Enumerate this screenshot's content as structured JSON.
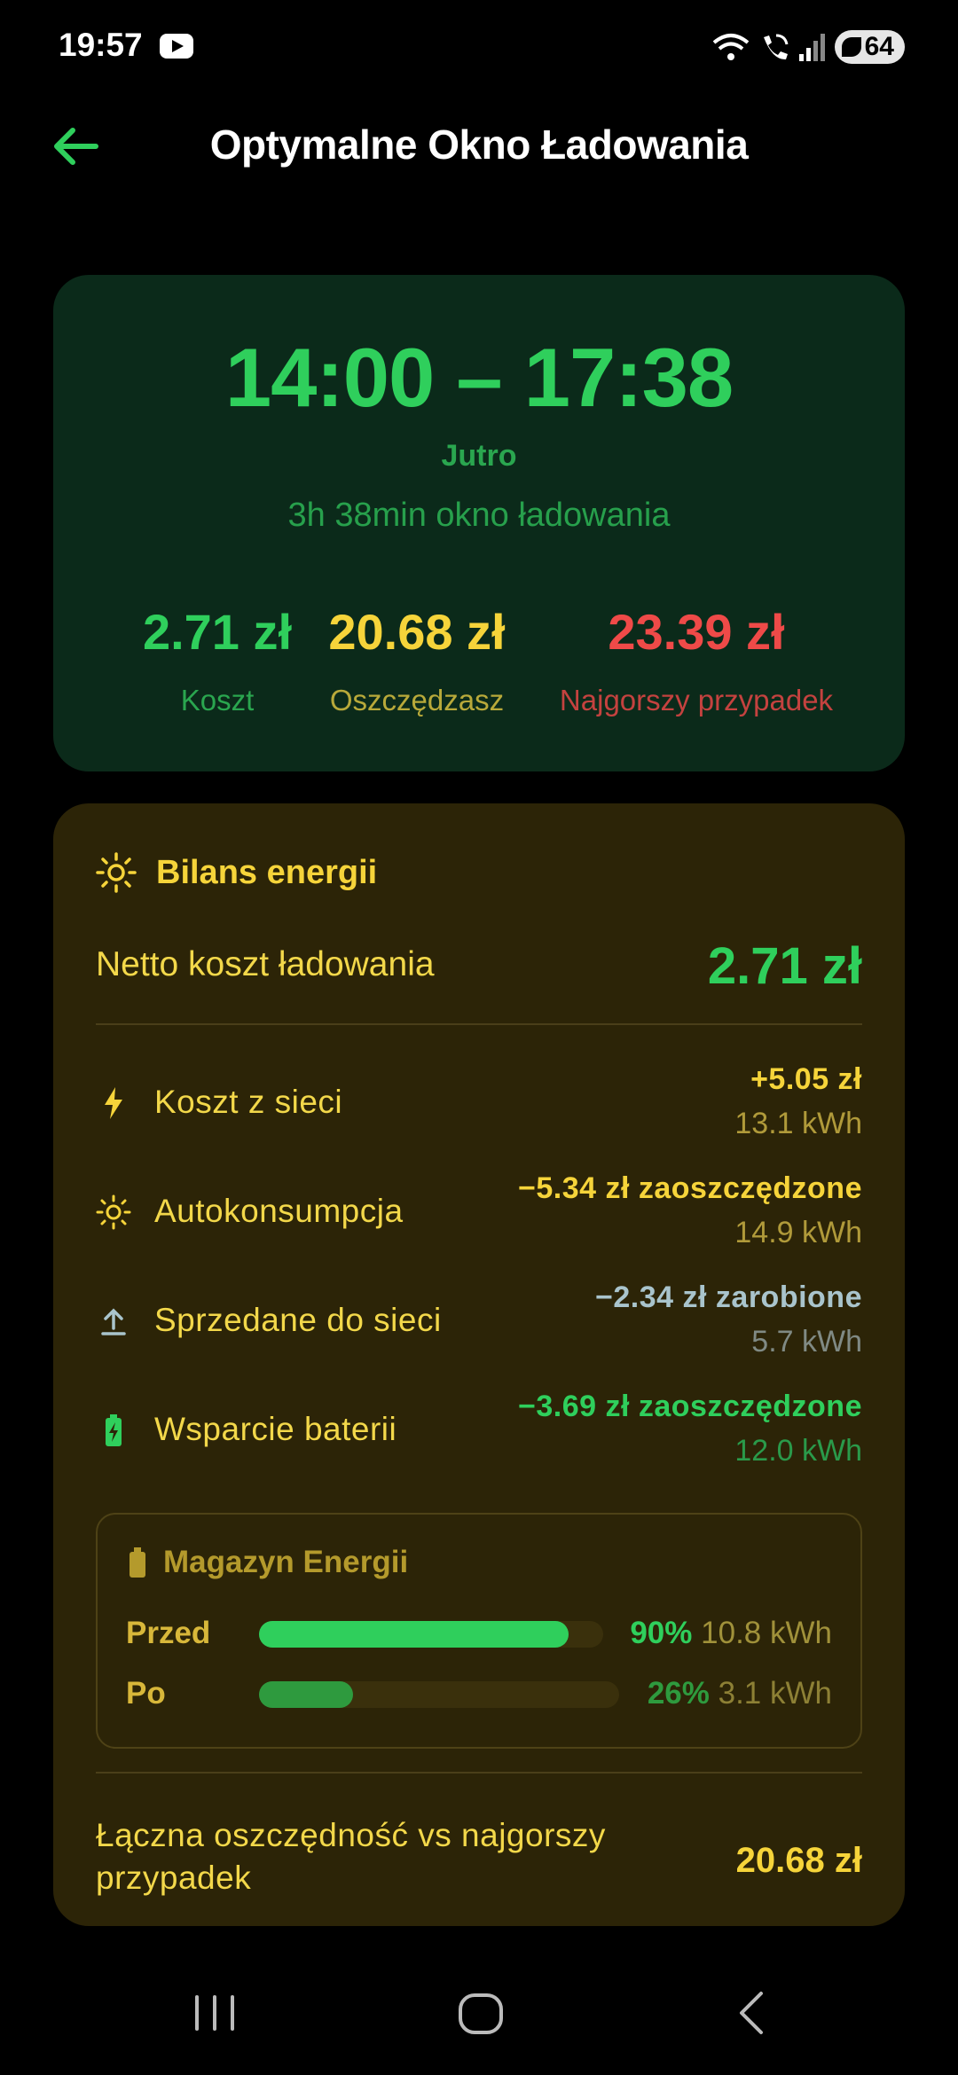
{
  "status_bar": {
    "time": "19:57",
    "battery_level": "64",
    "icons": [
      "youtube-icon",
      "wifi-icon",
      "wifi-call-icon",
      "signal-icon",
      "battery-saver-icon"
    ]
  },
  "header": {
    "title": "Optymalne Okno Ładowania",
    "back_icon": "arrow-left-icon"
  },
  "window_card": {
    "time_range": "14:00 – 17:38",
    "day": "Jutro",
    "duration": "3h 38min okno ładowania",
    "stats": [
      {
        "value": "2.71 zł",
        "label": "Koszt"
      },
      {
        "value": "20.68 zł",
        "label": "Oszczędzasz"
      },
      {
        "value": "23.39 zł",
        "label": "Najgorszy przypadek"
      }
    ],
    "colors": {
      "background": "#0b2a1a",
      "accent_green": "#2fcf5c",
      "accent_yellow": "#f6d43a",
      "accent_red": "#ef4a48"
    }
  },
  "energy_card": {
    "title": "Bilans energii",
    "title_icon": "sun-icon",
    "net_label": "Netto koszt ładowania",
    "net_value": "2.71 zł",
    "rows": [
      {
        "icon": "lightning-icon",
        "label": "Koszt z sieci",
        "amount": "+5.05 zł",
        "kwh": "13.1 kWh",
        "amount_color": "#f6d43a",
        "kwh_color": "#b09a3a"
      },
      {
        "icon": "sun-icon",
        "label": "Autokonsumpcja",
        "amount": "−5.34 zł zaoszczędzone",
        "kwh": "14.9 kWh",
        "amount_color": "#f6d43a",
        "kwh_color": "#b09a3a"
      },
      {
        "icon": "upload-icon",
        "label": "Sprzedane do sieci",
        "amount": "−2.34 zł zarobione",
        "kwh": "5.7 kWh",
        "amount_color": "#a9c4cc",
        "kwh_color": "#808a84"
      },
      {
        "icon": "battery-charging-icon",
        "label": "Wsparcie baterii",
        "amount": "−3.69 zł zaoszczędzone",
        "kwh": "12.0 kWh",
        "amount_color": "#2fcf5c",
        "kwh_color": "#2a9a4a"
      }
    ],
    "storage": {
      "title": "Magazyn Energii",
      "icon": "battery-icon",
      "before": {
        "label": "Przed",
        "percent": "90%",
        "kwh": "10.8 kWh",
        "level": 0.9
      },
      "after": {
        "label": "Po",
        "percent": "26%",
        "kwh": "3.1 kWh",
        "level": 0.26
      }
    },
    "total_label": "Łączna oszczędność vs najgorszy przypadek",
    "total_value": "20.68 zł",
    "colors": {
      "background": "#2c2407",
      "label": "#f3d84a"
    }
  },
  "nav_bar": {
    "icons": [
      "recent-apps-icon",
      "home-icon",
      "back-icon"
    ]
  }
}
